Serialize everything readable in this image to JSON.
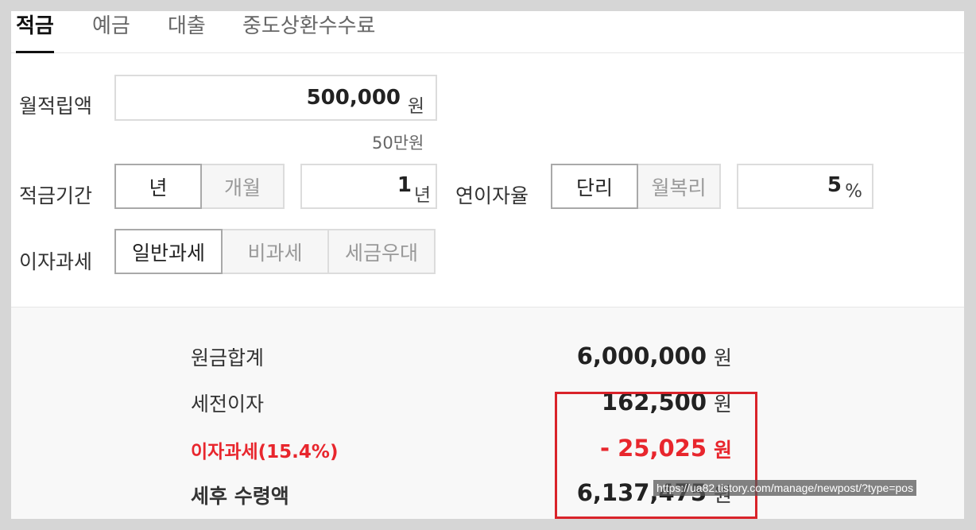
{
  "tabs": [
    {
      "label": "적금",
      "active": true
    },
    {
      "label": "예금",
      "active": false
    },
    {
      "label": "대출",
      "active": false
    },
    {
      "label": "중도상환수수료",
      "active": false
    }
  ],
  "form": {
    "monthly_label": "월적립액",
    "monthly_value": "500,000",
    "monthly_unit": "원",
    "monthly_hint": "50만원",
    "period_label": "적금기간",
    "period_options": [
      "년",
      "개월"
    ],
    "period_value": "1",
    "period_unit": "년",
    "rate_label": "연이자율",
    "rate_options": [
      "단리",
      "월복리"
    ],
    "rate_value": "5",
    "rate_unit": "%",
    "tax_label": "이자과세",
    "tax_options": [
      "일반과세",
      "비과세",
      "세금우대"
    ]
  },
  "results": {
    "principal_label": "원금합계",
    "principal_value": "6,000,000",
    "pretax_label": "세전이자",
    "pretax_value": "162,500",
    "tax_label": "이자과세(15.4%)",
    "tax_value": "- 25,025",
    "net_label": "세후 수령액",
    "net_value": "6,137,475",
    "unit": "원"
  },
  "overlay_url": "https://ua82.tistory.com/manage/newpost/?type=pos",
  "colors": {
    "accent_red": "#e8262d",
    "highlight_border": "#d9232a"
  }
}
